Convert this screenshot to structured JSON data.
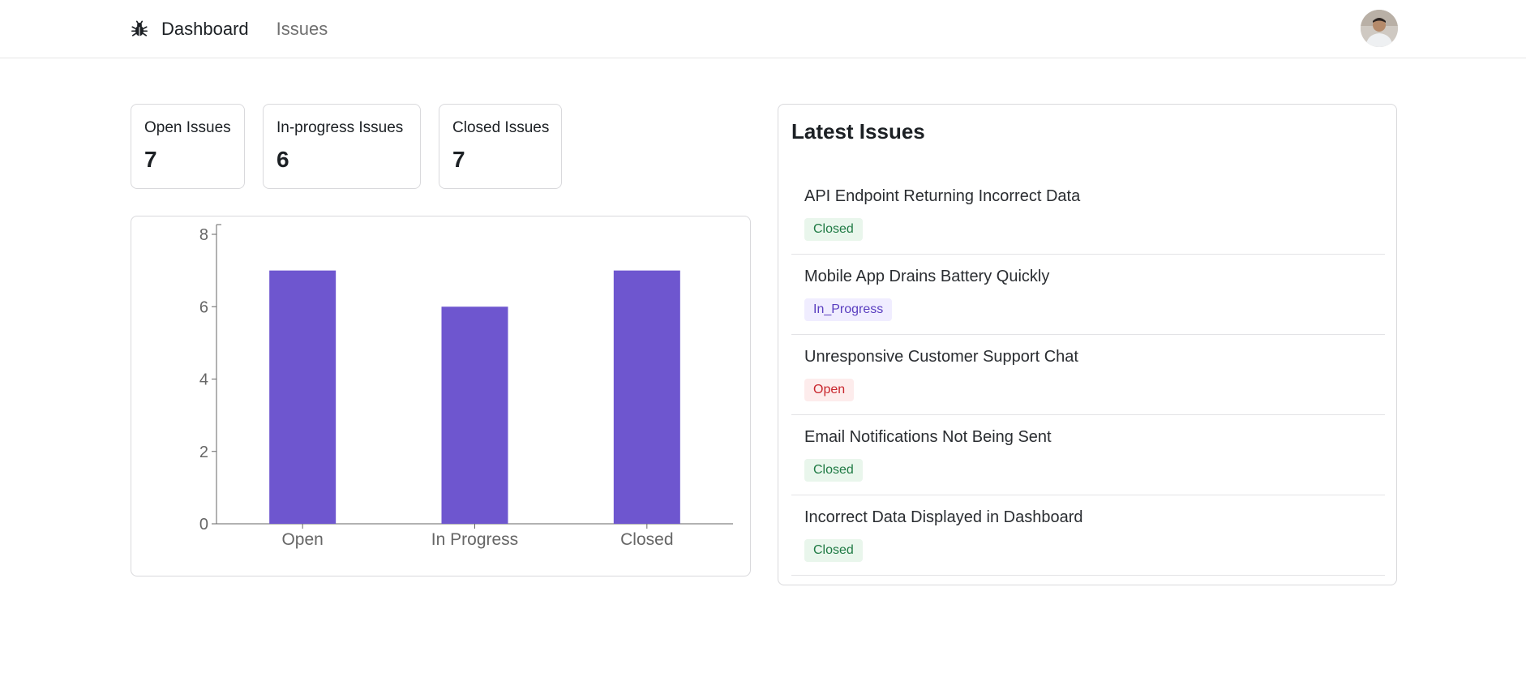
{
  "nav": {
    "logo_icon": "bug-icon",
    "links": [
      {
        "label": "Dashboard",
        "active": true
      },
      {
        "label": "Issues",
        "active": false
      }
    ],
    "avatar_icon": "user-avatar"
  },
  "stats": [
    {
      "label": "Open Issues",
      "value": "7"
    },
    {
      "label": "In-progress Issues",
      "value": "6"
    },
    {
      "label": "Closed Issues",
      "value": "7"
    }
  ],
  "chart_data": {
    "type": "bar",
    "categories": [
      "Open",
      "In Progress",
      "Closed"
    ],
    "values": [
      7,
      6,
      7
    ],
    "title": "",
    "xlabel": "",
    "ylabel": "",
    "ylim": [
      0,
      8
    ],
    "yticks": [
      "0",
      "2",
      "4",
      "6",
      "8"
    ],
    "bar_color": "#6e56cf",
    "grid": false
  },
  "latest": {
    "title": "Latest Issues",
    "issues": [
      {
        "title": "API Endpoint Returning Incorrect Data",
        "status": "Closed",
        "status_key": "closed"
      },
      {
        "title": "Mobile App Drains Battery Quickly",
        "status": "In_Progress",
        "status_key": "in_progress"
      },
      {
        "title": "Unresponsive Customer Support Chat",
        "status": "Open",
        "status_key": "open"
      },
      {
        "title": "Email Notifications Not Being Sent",
        "status": "Closed",
        "status_key": "closed"
      },
      {
        "title": "Incorrect Data Displayed in Dashboard",
        "status": "Closed",
        "status_key": "closed"
      }
    ]
  },
  "colors": {
    "closed": "#1f7a44",
    "in_progress": "#5a3fc0",
    "open": "#c8252c",
    "accent": "#6e56cf"
  }
}
